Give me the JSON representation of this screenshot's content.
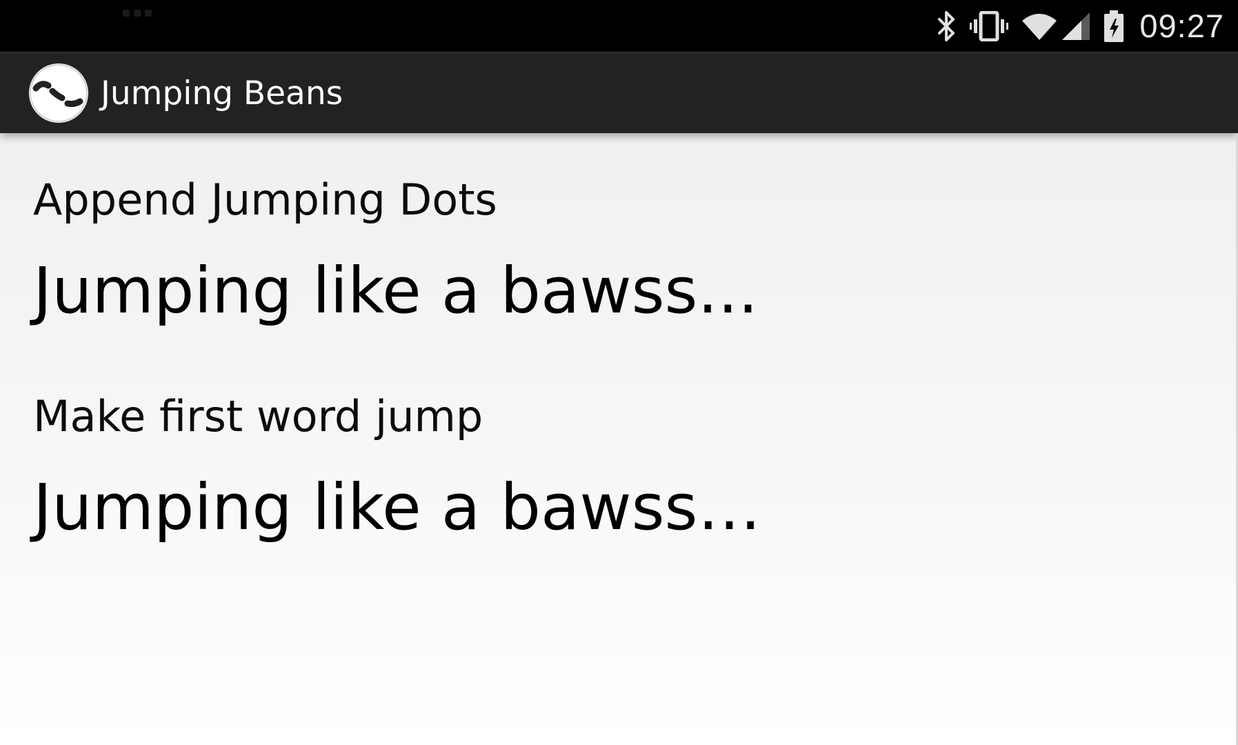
{
  "status_bar": {
    "time": "09:27",
    "icons": [
      "bluetooth-icon",
      "vibrate-icon",
      "wifi-icon",
      "cell-signal-icon",
      "battery-charging-icon"
    ]
  },
  "action_bar": {
    "app_icon": "jumping-beans-logo",
    "title": "Jumping Beans"
  },
  "sections": [
    {
      "label": "Append Jumping Dots",
      "text_base": "Jumping like a bawss",
      "trailing": "..."
    },
    {
      "label": "Make first word jump",
      "text": "Jumping like a bawss…"
    }
  ],
  "colors": {
    "status_bar": "#000000",
    "action_bar": "#222222",
    "text": "#000000"
  }
}
